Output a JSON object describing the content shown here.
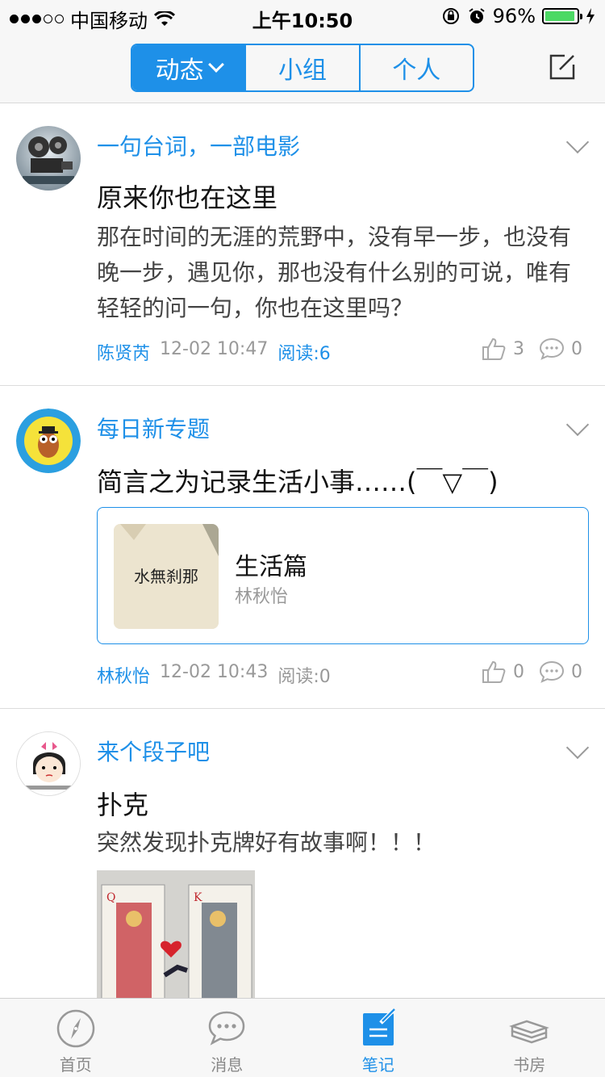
{
  "status_bar": {
    "carrier": "中国移动",
    "time": "上午10:50",
    "battery": "96%",
    "battery_level": 0.96
  },
  "nav": {
    "tabs": [
      {
        "label": "动态",
        "active": true
      },
      {
        "label": "小组",
        "active": false
      },
      {
        "label": "个人",
        "active": false
      }
    ],
    "compose_icon": "compose-icon"
  },
  "posts": [
    {
      "topic": "一句台词，一部电影",
      "title": "原来你也在这里",
      "body": "那在时间的无涯的荒野中，没有早一步，也没有晚一步，遇见你，那也没有什么别的可说，唯有轻轻的问一句，你也在这里吗？",
      "author": "陈贤芮",
      "time": "12-02 10:47",
      "reads": "阅读:6",
      "likes": "3",
      "comments": "0"
    },
    {
      "topic": "每日新专题",
      "title": "简言之为记录生活小事……(￣▽￣)",
      "card": {
        "title": "生活篇",
        "author": "林秋怡",
        "thumb_text": "水無刹那"
      },
      "author": "林秋怡",
      "time": "12-02 10:43",
      "reads": "阅读:0",
      "likes": "0",
      "comments": "0"
    },
    {
      "topic": "来个段子吧",
      "title": "扑克",
      "body": "突然发现扑克牌好有故事啊！！！"
    }
  ],
  "tabbar": [
    {
      "label": "首页",
      "icon": "compass-icon",
      "active": false
    },
    {
      "label": "消息",
      "icon": "chat-bubble-icon",
      "active": false
    },
    {
      "label": "笔记",
      "icon": "note-icon",
      "active": true
    },
    {
      "label": "书房",
      "icon": "books-icon",
      "active": false
    }
  ],
  "colors": {
    "accent": "#1e90e8",
    "battery": "#4cd964"
  }
}
